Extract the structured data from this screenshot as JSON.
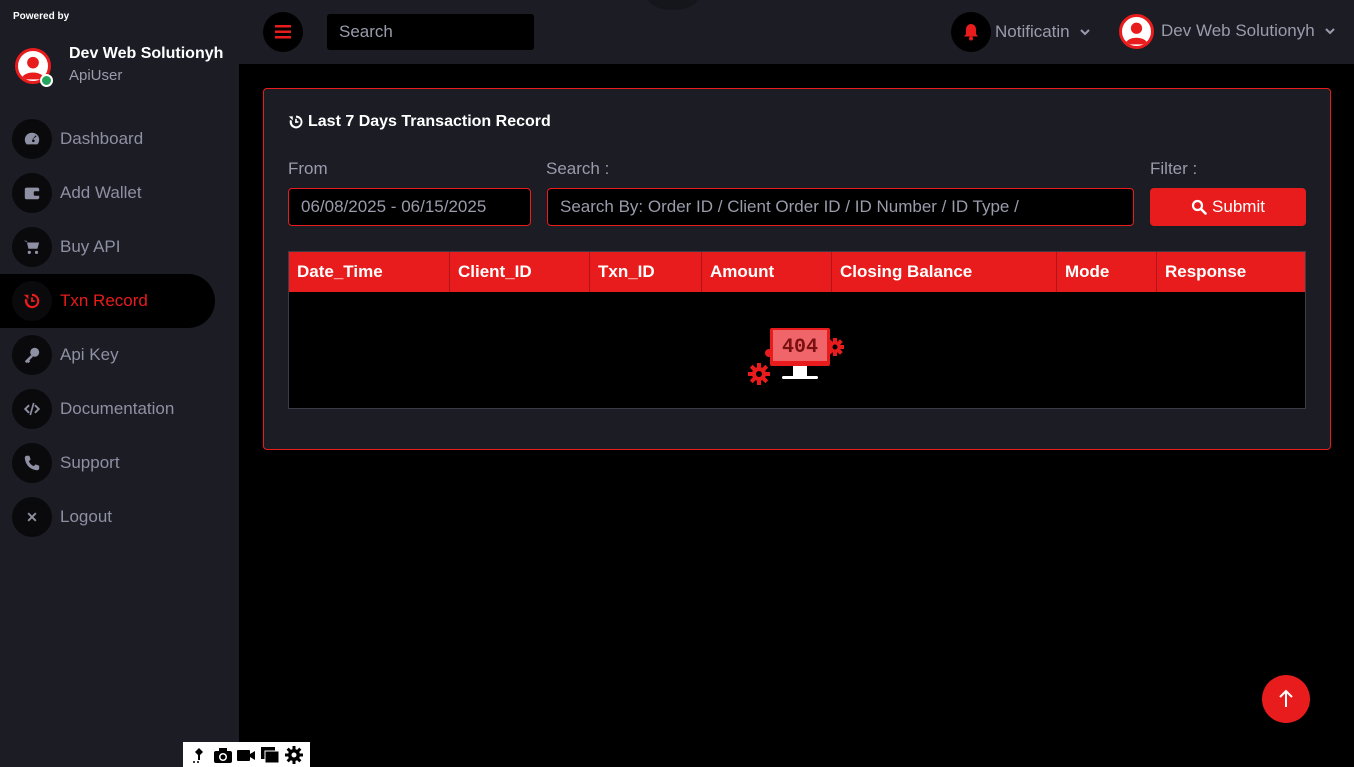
{
  "sidebar": {
    "powered_by": "Powered by",
    "profile": {
      "name": "Dev Web Solutionyh",
      "role": "ApiUser"
    },
    "items": [
      {
        "label": "Dashboard",
        "icon": "dashboard-icon",
        "active": false
      },
      {
        "label": "Add Wallet",
        "icon": "wallet-icon",
        "active": false
      },
      {
        "label": "Buy API",
        "icon": "cart-icon",
        "active": false
      },
      {
        "label": "Txn Record",
        "icon": "history-icon",
        "active": true
      },
      {
        "label": "Api Key",
        "icon": "key-icon",
        "active": false
      },
      {
        "label": "Documentation",
        "icon": "code-icon",
        "active": false
      },
      {
        "label": "Support",
        "icon": "phone-icon",
        "active": false
      },
      {
        "label": "Logout",
        "icon": "close-icon",
        "active": false
      }
    ]
  },
  "topbar": {
    "search_placeholder": "Search",
    "notification_label": "Notificatin",
    "user_label": "Dev Web Solutionyh"
  },
  "panel": {
    "title": "Last 7 Days Transaction Record",
    "from_label": "From",
    "from_value": "06/08/2025 - 06/15/2025",
    "search_label": "Search :",
    "search_placeholder": "Search By: Order ID / Client Order ID / ID Number / ID Type /",
    "filter_label": "Filter :",
    "submit_label": "Submit",
    "columns": [
      "Date_Time",
      "Client_ID",
      "Txn_ID",
      "Amount",
      "Closing Balance",
      "Mode",
      "Response"
    ],
    "empty_state_text": "404"
  },
  "colors": {
    "accent": "#e81c1c",
    "sidebar_bg": "#1b1c24",
    "page_bg": "#000000",
    "muted_text": "#9a9bab"
  }
}
